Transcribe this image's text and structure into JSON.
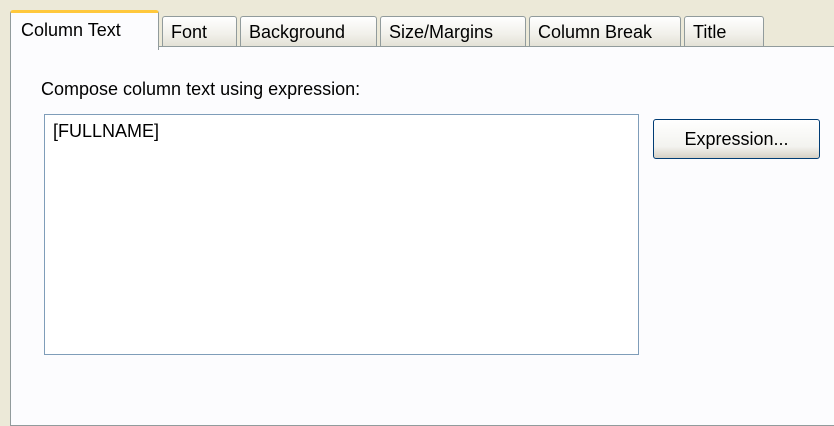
{
  "tabs": [
    {
      "label": "Column Text",
      "active": true
    },
    {
      "label": "Font",
      "active": false
    },
    {
      "label": "Background",
      "active": false
    },
    {
      "label": "Size/Margins",
      "active": false
    },
    {
      "label": "Column Break",
      "active": false
    },
    {
      "label": "Title",
      "active": false
    }
  ],
  "panel": {
    "prompt": "Compose column text using expression:",
    "expression_value": "[FULLNAME]",
    "expression_button_label": "Expression..."
  },
  "colors": {
    "active_tab_accent": "#FFC83C",
    "dialog_background": "#ECE9D8",
    "panel_background": "#FCFCFE",
    "border": "#919B9C"
  }
}
